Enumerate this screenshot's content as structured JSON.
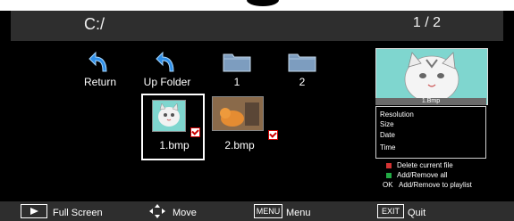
{
  "header": {
    "path": "C:/",
    "page_indicator": "1 / 2"
  },
  "browser": {
    "items": [
      {
        "label": "Return",
        "icon": "return-arrow-icon"
      },
      {
        "label": "Up Folder",
        "icon": "return-arrow-icon"
      },
      {
        "label": "1",
        "icon": "folder-icon"
      },
      {
        "label": "2",
        "icon": "folder-icon"
      }
    ],
    "files": [
      {
        "label": "1.bmp",
        "selected": true
      },
      {
        "label": "2.bmp",
        "selected": false
      }
    ]
  },
  "preview": {
    "caption": "1.Bmp",
    "info_labels": [
      "Resolution",
      "Size",
      "Date",
      "Time"
    ]
  },
  "legend": {
    "delete": "Delete current file",
    "add_all": "Add/Remove all",
    "ok_key": "OK",
    "add_playlist": "Add/Remove to playlist",
    "red_color": "#d33333",
    "green_color": "#22aa44"
  },
  "footer": {
    "fullscreen_label": "Full Screen",
    "move_label": "Move",
    "menu_key": "MENU",
    "menu_label": "Menu",
    "exit_key": "EXIT",
    "quit_label": "Quit"
  }
}
